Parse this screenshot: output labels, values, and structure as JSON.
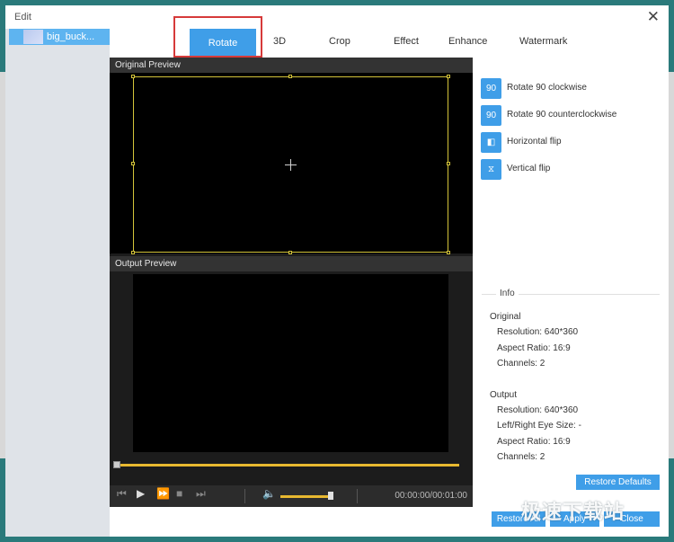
{
  "dialog": {
    "title": "Edit",
    "close_glyph": "✕"
  },
  "sidebar": {
    "items": [
      {
        "label": "big_buck..."
      }
    ]
  },
  "tabs": [
    {
      "label": "Rotate",
      "active": true
    },
    {
      "label": "3D"
    },
    {
      "label": "Crop"
    },
    {
      "label": "Effect"
    },
    {
      "label": "Enhance"
    },
    {
      "label": "Watermark"
    }
  ],
  "preview": {
    "original_title": "Original Preview",
    "output_title": "Output Preview",
    "timecode": "00:00:00/00:01:00",
    "seek_progress": 0.0,
    "volume_level": 0.85
  },
  "rotate_options": [
    {
      "label": "Rotate 90 clockwise",
      "icon": "rotate-cw-icon",
      "glyph": "90"
    },
    {
      "label": "Rotate 90 counterclockwise",
      "icon": "rotate-ccw-icon",
      "glyph": "90"
    },
    {
      "label": "Horizontal flip",
      "icon": "horizontal-flip-icon",
      "glyph": "◧"
    },
    {
      "label": "Vertical flip",
      "icon": "vertical-flip-icon",
      "glyph": "⧖"
    }
  ],
  "info": {
    "title": "Info",
    "original": {
      "heading": "Original",
      "resolution": "Resolution: 640*360",
      "aspect_ratio": "Aspect Ratio: 16:9",
      "channels": "Channels: 2"
    },
    "output": {
      "heading": "Output",
      "resolution": "Resolution: 640*360",
      "eye_size": "Left/Right Eye Size: -",
      "aspect_ratio": "Aspect Ratio: 16:9",
      "channels": "Channels: 2"
    }
  },
  "buttons": {
    "restore_defaults": "Restore Defaults",
    "restore_all": "Restore All",
    "apply": "Apply",
    "close": "Close"
  },
  "watermark_text": "极速下载站",
  "colors": {
    "accent": "#3f9ee8",
    "highlight": "#d63a3a",
    "progress": "#e8b830"
  }
}
